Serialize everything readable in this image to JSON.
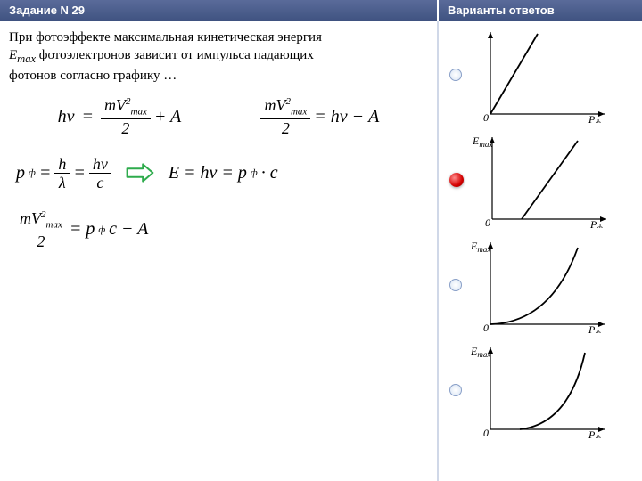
{
  "header": {
    "task_label": "Задание N 29",
    "answers_label": "Варианты ответов"
  },
  "question": {
    "line1": "При фотоэффекте максимальная кинетическая энергия",
    "emax": "Emax",
    "line2_rest": " фотоэлектронов зависит от импульса падающих",
    "line3": "фотонов согласно графику …"
  },
  "formulas": {
    "f1_lhs": "hν",
    "f1_frac_num": "mV",
    "f1_frac_sub": "max",
    "f1_frac_sup": "2",
    "f1_frac_den": "2",
    "f1_rhs": " + A",
    "f2_frac_num": "mV",
    "f2_frac_sub": "max",
    "f2_frac_sup": "2",
    "f2_frac_den": "2",
    "f2_rhs": " = hν − A",
    "p_lhs": "p",
    "p_sub": "ф",
    "p_eq": " = ",
    "p_frac1_num": "h",
    "p_frac1_den": "λ",
    "p_frac2_num": "hν",
    "p_frac2_den": "c",
    "e_expr1": "E = hν = p",
    "e_sub": "ф",
    "e_expr2": " · c",
    "f3_frac_num": "mV",
    "f3_frac_sub": "max",
    "f3_frac_sup": "2",
    "f3_frac_den": "2",
    "f3_rhs1": " = p",
    "f3_sub": "ф",
    "f3_rhs2": "c − A"
  },
  "options": {
    "sel_index": 1,
    "y_label": "Emax",
    "x_label": "Pф",
    "origin": "0",
    "shapes": [
      "linear_through_origin",
      "linear_offset",
      "convex_up",
      "concave_up"
    ]
  }
}
